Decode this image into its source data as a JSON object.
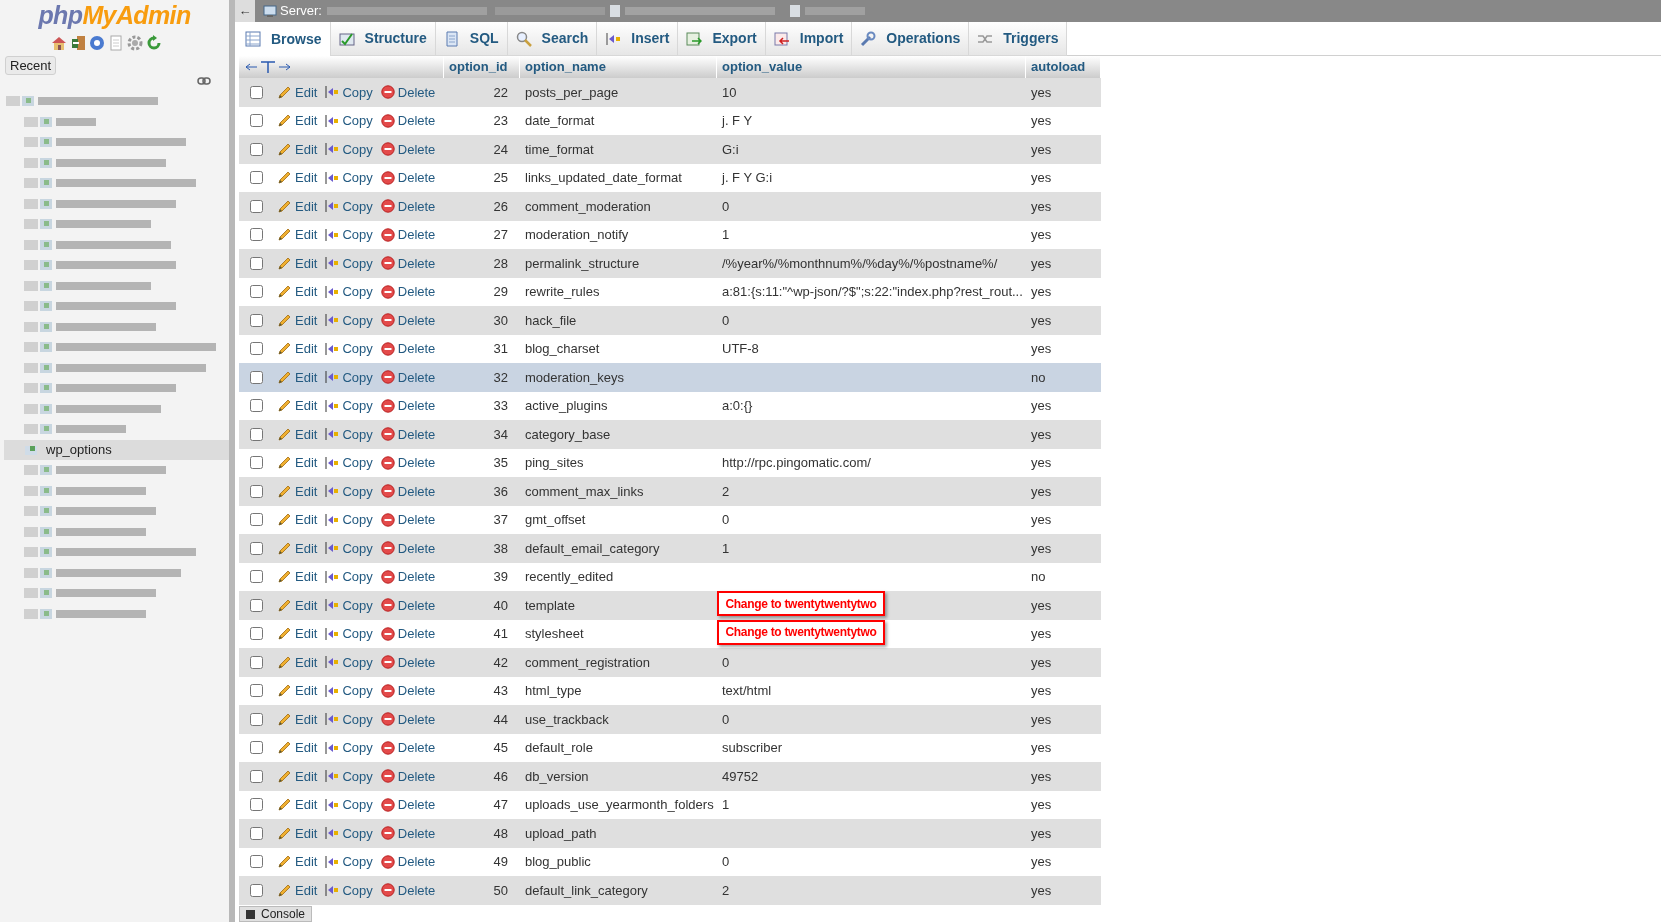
{
  "sidebar": {
    "logo": [
      "php",
      "MyAdmin"
    ],
    "recent_button": "Recent",
    "tree": [
      {
        "kind": "blurred",
        "selected": false
      },
      {
        "kind": "blurred",
        "selected": false
      },
      {
        "kind": "blurred",
        "selected": false
      },
      {
        "kind": "blurred",
        "selected": false
      },
      {
        "kind": "blurred",
        "selected": false
      },
      {
        "kind": "blurred",
        "selected": false
      },
      {
        "kind": "blurred",
        "selected": false
      },
      {
        "kind": "blurred",
        "selected": false
      },
      {
        "kind": "blurred",
        "selected": false
      },
      {
        "kind": "blurred",
        "selected": false
      },
      {
        "kind": "blurred",
        "selected": false
      },
      {
        "kind": "blurred",
        "selected": false
      },
      {
        "kind": "blurred",
        "selected": false
      },
      {
        "kind": "blurred",
        "selected": false
      },
      {
        "kind": "blurred",
        "selected": false
      },
      {
        "kind": "blurred",
        "selected": false
      },
      {
        "kind": "blurred",
        "selected": false
      },
      {
        "kind": "table",
        "label": "wp_options",
        "selected": true
      },
      {
        "kind": "blurred",
        "selected": false
      },
      {
        "kind": "blurred",
        "selected": false
      },
      {
        "kind": "blurred",
        "selected": false
      },
      {
        "kind": "blurred",
        "selected": false
      },
      {
        "kind": "blurred",
        "selected": false
      },
      {
        "kind": "blurred",
        "selected": false
      },
      {
        "kind": "blurred",
        "selected": false
      },
      {
        "kind": "blurred",
        "selected": false
      }
    ]
  },
  "breadcrumb": {
    "arrow": "←",
    "label": "Server:"
  },
  "tabs": [
    {
      "label": "Browse",
      "selected": true
    },
    {
      "label": "Structure",
      "selected": false
    },
    {
      "label": "SQL",
      "selected": false
    },
    {
      "label": "Search",
      "selected": false
    },
    {
      "label": "Insert",
      "selected": false
    },
    {
      "label": "Export",
      "selected": false
    },
    {
      "label": "Import",
      "selected": false
    },
    {
      "label": "Operations",
      "selected": false
    },
    {
      "label": "Triggers",
      "selected": false
    }
  ],
  "table": {
    "columns": [
      "option_id",
      "option_name",
      "option_value",
      "autoload"
    ],
    "rows": [
      {
        "actions": [
          "Edit",
          "Copy",
          "Delete"
        ],
        "option_id": "22",
        "option_name": "posts_per_page",
        "option_value": "10",
        "autoload": "yes",
        "checked": false,
        "highlighted": false
      },
      {
        "actions": [
          "Edit",
          "Copy",
          "Delete"
        ],
        "option_id": "23",
        "option_name": "date_format",
        "option_value": "j. F Y",
        "autoload": "yes",
        "checked": false,
        "highlighted": false
      },
      {
        "actions": [
          "Edit",
          "Copy",
          "Delete"
        ],
        "option_id": "24",
        "option_name": "time_format",
        "option_value": "G:i",
        "autoload": "yes",
        "checked": false,
        "highlighted": false
      },
      {
        "actions": [
          "Edit",
          "Copy",
          "Delete"
        ],
        "option_id": "25",
        "option_name": "links_updated_date_format",
        "option_value": "j. F Y G:i",
        "autoload": "yes",
        "checked": false,
        "highlighted": false
      },
      {
        "actions": [
          "Edit",
          "Copy",
          "Delete"
        ],
        "option_id": "26",
        "option_name": "comment_moderation",
        "option_value": "0",
        "autoload": "yes",
        "checked": false,
        "highlighted": false
      },
      {
        "actions": [
          "Edit",
          "Copy",
          "Delete"
        ],
        "option_id": "27",
        "option_name": "moderation_notify",
        "option_value": "1",
        "autoload": "yes",
        "checked": false,
        "highlighted": false
      },
      {
        "actions": [
          "Edit",
          "Copy",
          "Delete"
        ],
        "option_id": "28",
        "option_name": "permalink_structure",
        "option_value": "/%year%/%monthnum%/%day%/%postname%/",
        "autoload": "yes",
        "checked": false,
        "highlighted": false
      },
      {
        "actions": [
          "Edit",
          "Copy",
          "Delete"
        ],
        "option_id": "29",
        "option_name": "rewrite_rules",
        "option_value": "a:81:{s:11:\"^wp-json/?$\";s:22:\"index.php?rest_rout...",
        "autoload": "yes",
        "checked": false,
        "highlighted": false
      },
      {
        "actions": [
          "Edit",
          "Copy",
          "Delete"
        ],
        "option_id": "30",
        "option_name": "hack_file",
        "option_value": "0",
        "autoload": "yes",
        "checked": false,
        "highlighted": false
      },
      {
        "actions": [
          "Edit",
          "Copy",
          "Delete"
        ],
        "option_id": "31",
        "option_name": "blog_charset",
        "option_value": "UTF-8",
        "autoload": "yes",
        "checked": false,
        "highlighted": false
      },
      {
        "actions": [
          "Edit",
          "Copy",
          "Delete"
        ],
        "option_id": "32",
        "option_name": "moderation_keys",
        "autoload": "no",
        "checked": false,
        "highlighted": true
      },
      {
        "actions": [
          "Edit",
          "Copy",
          "Delete"
        ],
        "option_id": "33",
        "option_name": "active_plugins",
        "option_value": "a:0:{}",
        "autoload": "yes",
        "checked": false,
        "highlighted": false
      },
      {
        "actions": [
          "Edit",
          "Copy",
          "Delete"
        ],
        "option_id": "34",
        "option_name": "category_base",
        "autoload": "yes",
        "checked": false,
        "highlighted": false
      },
      {
        "actions": [
          "Edit",
          "Copy",
          "Delete"
        ],
        "option_id": "35",
        "option_name": "ping_sites",
        "option_value": "http://rpc.pingomatic.com/",
        "autoload": "yes",
        "checked": false,
        "highlighted": false
      },
      {
        "actions": [
          "Edit",
          "Copy",
          "Delete"
        ],
        "option_id": "36",
        "option_name": "comment_max_links",
        "option_value": "2",
        "autoload": "yes",
        "checked": false,
        "highlighted": false
      },
      {
        "actions": [
          "Edit",
          "Copy",
          "Delete"
        ],
        "option_id": "37",
        "option_name": "gmt_offset",
        "option_value": "0",
        "autoload": "yes",
        "checked": false,
        "highlighted": false
      },
      {
        "actions": [
          "Edit",
          "Copy",
          "Delete"
        ],
        "option_id": "38",
        "option_name": "default_email_category",
        "option_value": "1",
        "autoload": "yes",
        "checked": false,
        "highlighted": false
      },
      {
        "actions": [
          "Edit",
          "Copy",
          "Delete"
        ],
        "option_id": "39",
        "option_name": "recently_edited",
        "autoload": "no",
        "checked": false,
        "highlighted": false
      },
      {
        "actions": [
          "Edit",
          "Copy",
          "Delete"
        ],
        "option_id": "40",
        "option_name": "template",
        "annotation": "Change to twentytwentytwo",
        "autoload": "yes",
        "checked": false,
        "highlighted": false
      },
      {
        "actions": [
          "Edit",
          "Copy",
          "Delete"
        ],
        "option_id": "41",
        "option_name": "stylesheet",
        "annotation": "Change to twentytwentytwo",
        "autoload": "yes",
        "checked": false,
        "highlighted": false
      },
      {
        "actions": [
          "Edit",
          "Copy",
          "Delete"
        ],
        "option_id": "42",
        "option_name": "comment_registration",
        "option_value": "0",
        "autoload": "yes",
        "checked": false,
        "highlighted": false
      },
      {
        "actions": [
          "Edit",
          "Copy",
          "Delete"
        ],
        "option_id": "43",
        "option_name": "html_type",
        "option_value": "text/html",
        "autoload": "yes",
        "checked": false,
        "highlighted": false
      },
      {
        "actions": [
          "Edit",
          "Copy",
          "Delete"
        ],
        "option_id": "44",
        "option_name": "use_trackback",
        "option_value": "0",
        "autoload": "yes",
        "checked": false,
        "highlighted": false
      },
      {
        "actions": [
          "Edit",
          "Copy",
          "Delete"
        ],
        "option_id": "45",
        "option_name": "default_role",
        "option_value": "subscriber",
        "autoload": "yes",
        "checked": false,
        "highlighted": false
      },
      {
        "actions": [
          "Edit",
          "Copy",
          "Delete"
        ],
        "option_id": "46",
        "option_name": "db_version",
        "option_value": "49752",
        "autoload": "yes",
        "checked": false,
        "highlighted": false
      },
      {
        "actions": [
          "Edit",
          "Copy",
          "Delete"
        ],
        "option_id": "47",
        "option_name": "uploads_use_yearmonth_folders",
        "option_value": "1",
        "autoload": "yes",
        "checked": false,
        "highlighted": false
      },
      {
        "actions": [
          "Edit",
          "Copy",
          "Delete"
        ],
        "option_id": "48",
        "option_name": "upload_path",
        "autoload": "yes",
        "checked": false,
        "highlighted": false
      },
      {
        "actions": [
          "Edit",
          "Copy",
          "Delete"
        ],
        "option_id": "49",
        "option_name": "blog_public",
        "option_value": "0",
        "autoload": "yes",
        "checked": false,
        "highlighted": false
      },
      {
        "actions": [
          "Edit",
          "Copy",
          "Delete"
        ],
        "option_id": "50",
        "option_name": "default_link_category",
        "option_value": "2",
        "autoload": "yes",
        "checked": false,
        "highlighted": false
      }
    ]
  },
  "console_button": "Console"
}
